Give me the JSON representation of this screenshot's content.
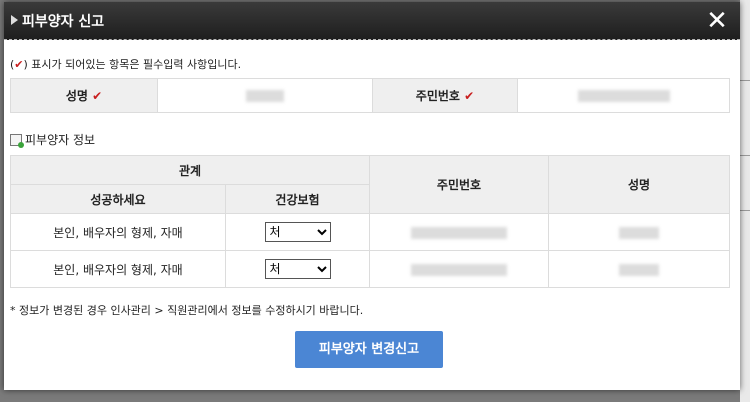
{
  "dialog": {
    "title": "피부양자 신고",
    "close_icon": "✕",
    "required_notice": ") 표시가 되어있는 항목은 필수입력 사항입니다.",
    "notice_open": "(",
    "check_icon": "✔"
  },
  "applicant": {
    "name_label": "성명",
    "rrn_label": "주민번호"
  },
  "dependent_section": {
    "title": "피부양자 정보",
    "headers": {
      "relation": "관계",
      "ssc": "성공하세요",
      "health": "건강보험",
      "rrn": "주민번호",
      "name": "성명"
    },
    "rows": [
      {
        "relation": "본인, 배우자의 형제, 자매",
        "health": "처"
      },
      {
        "relation": "본인, 배우자의 형제, 자매",
        "health": "처"
      }
    ]
  },
  "footer_note": "* 정보가 변경된 경우 인사관리 > 직원관리에서 정보를 수정하시기 바랍니다.",
  "submit_label": "피부양자 변경신고"
}
